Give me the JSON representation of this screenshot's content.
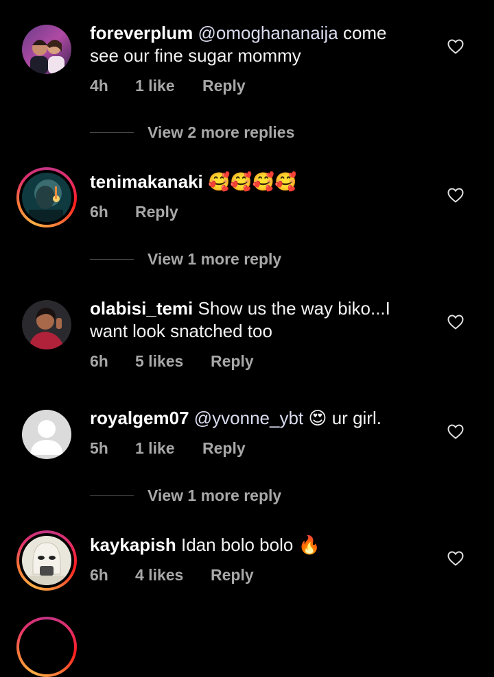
{
  "comments": [
    {
      "username": "foreverplum",
      "mention": "@omoghananaija",
      "text_line1": " come",
      "text_line2": "see our fine sugar mommy",
      "time": "4h",
      "likes": "1 like",
      "reply": "Reply",
      "view_more": "View 2 more replies",
      "has_story_ring": false
    },
    {
      "username": "tenimakanaki",
      "emojis": "🥰🥰🥰🥰",
      "time": "6h",
      "reply": "Reply",
      "view_more": "View 1 more reply",
      "has_story_ring": true
    },
    {
      "username": "olabisi_temi",
      "text_line1": " Show us the way biko...I",
      "text_line2": "want look snatched too",
      "time": "6h",
      "likes": "5 likes",
      "reply": "Reply",
      "has_story_ring": false
    },
    {
      "username": "royalgem07",
      "mention": "@yvonne_ybt",
      "emoji": "😍",
      "text_after": " ur girl.",
      "time": "5h",
      "likes": "1 like",
      "reply": "Reply",
      "view_more": "View 1 more reply",
      "has_story_ring": false
    },
    {
      "username": "kaykapish",
      "text": " Idan bolo bolo ",
      "emoji": "🔥",
      "time": "6h",
      "likes": "4 likes",
      "reply": "Reply",
      "has_story_ring": true
    }
  ],
  "icons": {
    "like": "heart-outline-icon",
    "default_avatar": "default-avatar-icon"
  },
  "colors": {
    "background": "#000000",
    "meta_text": "#a8a8a8",
    "story_ring_start": "#c13584",
    "story_ring_end": "#fcaf45"
  }
}
